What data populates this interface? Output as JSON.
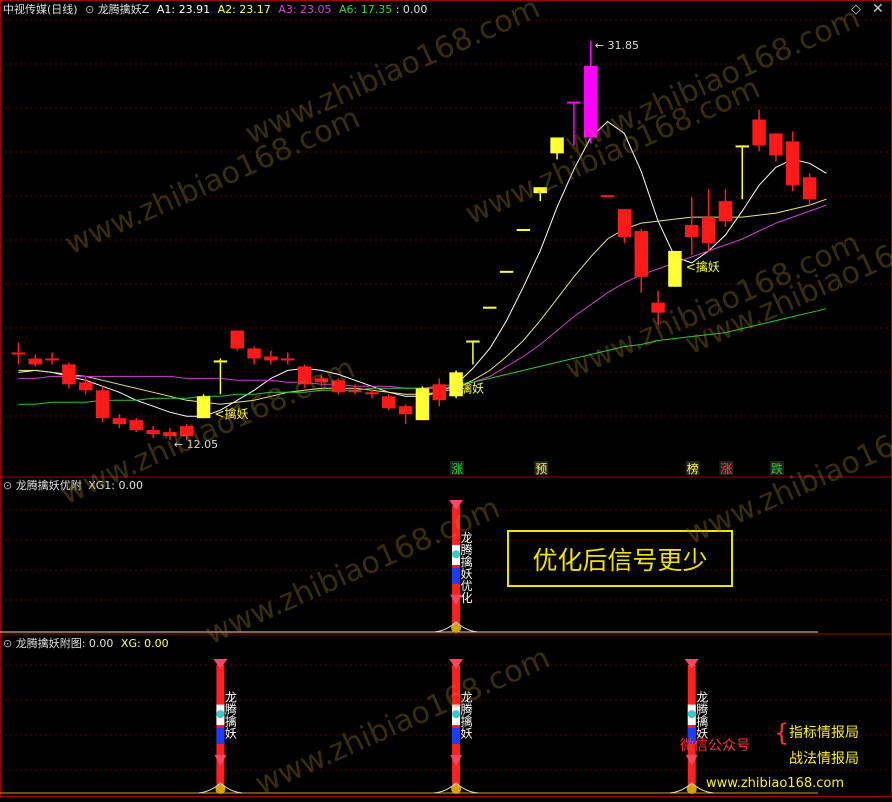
{
  "header": {
    "stock_name": "中视传媒",
    "period": "(日线)",
    "indicator_name": "龙腾擒妖Z",
    "a1": "A1: 23.91",
    "a2": "A2: 23.17",
    "a3": "A3: 23.05",
    "a6": "A6: 17.35",
    "extra": ": 0.00"
  },
  "colors": {
    "up": "#ff1a1a",
    "down_or_yellow": "#ffff33",
    "magenta": "#ff00ff",
    "ma_white": "#ffffff",
    "ma_yellow": "#e6e68a",
    "ma_magenta": "#d040d0",
    "ma_green": "#2ec82e",
    "signal_red": "#ff2020",
    "signal_blue": "#1a3cff",
    "grid": "#5a0000",
    "border": "#a00000"
  },
  "chart_data": {
    "type": "candlestick",
    "title": "中视传媒 (日线)",
    "price_labels": {
      "high": "31.85",
      "low": "12.05"
    },
    "ylim": [
      11,
      33
    ],
    "x": [
      1,
      2,
      3,
      4,
      5,
      6,
      7,
      8,
      9,
      10,
      11,
      12,
      13,
      14,
      15,
      16,
      17,
      18,
      19,
      20,
      21,
      22,
      23,
      24,
      25,
      26,
      27,
      28,
      29,
      30,
      31,
      32,
      33,
      34,
      35,
      36,
      37,
      38,
      39,
      40,
      41,
      42,
      43,
      44,
      45,
      46,
      47,
      48
    ],
    "candles": [
      {
        "o": 16.2,
        "h": 16.7,
        "l": 15.6,
        "c": 16.1,
        "col": "red"
      },
      {
        "o": 15.9,
        "h": 16.1,
        "l": 15.5,
        "c": 15.6,
        "col": "red"
      },
      {
        "o": 15.9,
        "h": 16.2,
        "l": 15.6,
        "c": 15.8,
        "col": "red"
      },
      {
        "o": 15.6,
        "h": 15.7,
        "l": 14.4,
        "c": 14.6,
        "col": "red"
      },
      {
        "o": 14.7,
        "h": 15.0,
        "l": 14.1,
        "c": 14.3,
        "col": "red"
      },
      {
        "o": 14.3,
        "h": 14.5,
        "l": 12.7,
        "c": 12.9,
        "col": "red"
      },
      {
        "o": 12.9,
        "h": 13.1,
        "l": 12.4,
        "c": 12.6,
        "col": "red"
      },
      {
        "o": 12.8,
        "h": 12.9,
        "l": 12.2,
        "c": 12.3,
        "col": "red"
      },
      {
        "o": 12.3,
        "h": 12.5,
        "l": 11.9,
        "c": 12.1,
        "col": "red"
      },
      {
        "o": 12.2,
        "h": 12.4,
        "l": 11.8,
        "c": 12.0,
        "col": "red"
      },
      {
        "o": 12.0,
        "h": 12.6,
        "l": 11.8,
        "c": 12.5,
        "col": "red"
      },
      {
        "o": 12.9,
        "h": 14.1,
        "l": 12.9,
        "c": 14.0,
        "col": "yellow"
      },
      {
        "o": 15.8,
        "h": 15.9,
        "l": 14.1,
        "c": 15.8,
        "col": "yellow"
      },
      {
        "o": 17.3,
        "h": 17.3,
        "l": 16.3,
        "c": 16.4,
        "col": "red"
      },
      {
        "o": 16.4,
        "h": 16.5,
        "l": 15.6,
        "c": 15.9,
        "col": "red"
      },
      {
        "o": 16.0,
        "h": 16.3,
        "l": 15.6,
        "c": 15.8,
        "col": "red"
      },
      {
        "o": 15.9,
        "h": 16.2,
        "l": 15.6,
        "c": 15.8,
        "col": "red"
      },
      {
        "o": 15.5,
        "h": 15.6,
        "l": 14.4,
        "c": 14.6,
        "col": "red"
      },
      {
        "o": 14.9,
        "h": 15.1,
        "l": 14.5,
        "c": 14.7,
        "col": "red"
      },
      {
        "o": 14.8,
        "h": 14.9,
        "l": 14.1,
        "c": 14.2,
        "col": "red"
      },
      {
        "o": 14.3,
        "h": 14.6,
        "l": 14.1,
        "c": 14.3,
        "col": "red"
      },
      {
        "o": 14.2,
        "h": 14.4,
        "l": 13.9,
        "c": 14.1,
        "col": "red"
      },
      {
        "o": 14.0,
        "h": 14.1,
        "l": 13.3,
        "c": 13.4,
        "col": "red"
      },
      {
        "o": 13.5,
        "h": 13.6,
        "l": 12.6,
        "c": 13.1,
        "col": "red"
      },
      {
        "o": 12.8,
        "h": 14.5,
        "l": 12.8,
        "c": 14.4,
        "col": "yellow"
      },
      {
        "o": 13.8,
        "h": 14.9,
        "l": 13.5,
        "c": 14.6,
        "col": "red"
      },
      {
        "o": 14.0,
        "h": 15.3,
        "l": 13.9,
        "c": 15.2,
        "col": "yellow"
      },
      {
        "o": 16.8,
        "h": 16.8,
        "l": 15.6,
        "c": 16.8,
        "col": "yellow"
      },
      {
        "o": 18.5,
        "h": 18.5,
        "l": 18.5,
        "c": 18.5,
        "col": "yellow"
      },
      {
        "o": 20.3,
        "h": 20.3,
        "l": 20.3,
        "c": 20.3,
        "col": "yellow"
      },
      {
        "o": 22.4,
        "h": 22.4,
        "l": 22.4,
        "c": 22.4,
        "col": "yellow"
      },
      {
        "o": 24.5,
        "h": 24.5,
        "l": 23.8,
        "c": 24.2,
        "col": "yellow"
      },
      {
        "o": 26.2,
        "h": 27.0,
        "l": 25.9,
        "c": 27.0,
        "col": "yellow"
      },
      {
        "o": 28.8,
        "h": 28.8,
        "l": 26.6,
        "c": 28.8,
        "col": "magenta"
      },
      {
        "o": 27.0,
        "h": 31.85,
        "l": 26.7,
        "c": 30.6,
        "col": "magenta"
      },
      {
        "o": 24.1,
        "h": 24.1,
        "l": 24.1,
        "c": 24.1,
        "col": "red"
      },
      {
        "o": 23.4,
        "h": 23.4,
        "l": 21.7,
        "c": 22.0,
        "col": "red"
      },
      {
        "o": 22.3,
        "h": 22.4,
        "l": 19.2,
        "c": 20.0,
        "col": "red"
      },
      {
        "o": 18.7,
        "h": 19.3,
        "l": 17.6,
        "c": 18.2,
        "col": "red"
      },
      {
        "o": 19.5,
        "h": 21.3,
        "l": 19.5,
        "c": 21.3,
        "col": "yellow"
      },
      {
        "o": 22.6,
        "h": 24.0,
        "l": 21.1,
        "c": 22.0,
        "col": "red"
      },
      {
        "o": 23.0,
        "h": 24.4,
        "l": 21.3,
        "c": 21.7,
        "col": "red"
      },
      {
        "o": 23.8,
        "h": 24.4,
        "l": 22.5,
        "c": 22.8,
        "col": "red"
      },
      {
        "o": 26.6,
        "h": 26.6,
        "l": 23.9,
        "c": 26.6,
        "col": "yellow"
      },
      {
        "o": 27.9,
        "h": 28.4,
        "l": 26.3,
        "c": 26.6,
        "col": "red"
      },
      {
        "o": 27.2,
        "h": 27.2,
        "l": 25.8,
        "c": 26.1,
        "col": "red"
      },
      {
        "o": 26.8,
        "h": 27.3,
        "l": 24.3,
        "c": 24.6,
        "col": "red"
      },
      {
        "o": 25.0,
        "h": 25.2,
        "l": 23.6,
        "c": 23.9,
        "col": "red"
      }
    ],
    "lines": [
      {
        "name": "A1",
        "color": "#ffffff",
        "values": [
          15.2,
          15.3,
          15.2,
          15.0,
          14.8,
          14.5,
          14.2,
          13.8,
          13.5,
          13.2,
          13.0,
          13.0,
          13.3,
          13.8,
          14.3,
          14.9,
          15.3,
          15.4,
          15.3,
          15.1,
          14.8,
          14.5,
          14.2,
          14.0,
          14.0,
          14.2,
          14.6,
          15.4,
          16.4,
          17.8,
          19.5,
          21.3,
          23.5,
          25.4,
          27.0,
          27.8,
          27.2,
          25.3,
          22.8,
          21.0,
          20.7,
          21.3,
          22.1,
          23.3,
          24.6,
          25.5,
          25.9,
          25.7,
          25.2
        ]
      },
      {
        "name": "A2",
        "color": "#e6e68a",
        "values": [
          15.3,
          15.3,
          15.2,
          15.1,
          15.0,
          14.8,
          14.6,
          14.4,
          14.2,
          14.0,
          13.8,
          13.7,
          13.6,
          13.7,
          13.8,
          14.0,
          14.2,
          14.3,
          14.4,
          14.4,
          14.4,
          14.3,
          14.2,
          14.1,
          14.1,
          14.2,
          14.4,
          14.8,
          15.3,
          16.0,
          16.8,
          17.8,
          18.9,
          20.0,
          21.0,
          21.9,
          22.4,
          22.7,
          22.8,
          22.9,
          23.0,
          23.0,
          23.0,
          23.0,
          23.1,
          23.2,
          23.4,
          23.6,
          23.9
        ]
      },
      {
        "name": "A3",
        "color": "#d040d0",
        "values": [
          14.9,
          14.9,
          15.0,
          15.0,
          15.0,
          15.0,
          15.0,
          15.0,
          15.0,
          15.0,
          14.9,
          14.9,
          14.9,
          14.8,
          14.8,
          14.8,
          14.7,
          14.7,
          14.6,
          14.6,
          14.5,
          14.5,
          14.5,
          14.4,
          14.4,
          14.4,
          14.5,
          14.7,
          15.0,
          15.5,
          16.0,
          16.6,
          17.3,
          18.0,
          18.6,
          19.2,
          19.7,
          20.1,
          20.4,
          20.7,
          21.0,
          21.3,
          21.6,
          21.9,
          22.3,
          22.7,
          23.0,
          23.3,
          23.6
        ]
      },
      {
        "name": "A6",
        "color": "#2ec82e",
        "values": [
          13.6,
          13.6,
          13.7,
          13.7,
          13.7,
          13.8,
          13.8,
          13.8,
          13.9,
          13.9,
          13.9,
          14.0,
          14.0,
          14.1,
          14.1,
          14.2,
          14.2,
          14.2,
          14.3,
          14.3,
          14.3,
          14.4,
          14.4,
          14.4,
          14.4,
          14.5,
          14.6,
          14.7,
          14.9,
          15.1,
          15.3,
          15.5,
          15.7,
          15.9,
          16.1,
          16.3,
          16.5,
          16.6,
          16.8,
          16.9,
          17.0,
          17.1,
          17.2,
          17.4,
          17.6,
          17.8,
          18.0,
          18.2,
          18.4
        ]
      }
    ],
    "signals": [
      {
        "idx": 12,
        "label": "擒妖"
      },
      {
        "idx": 26,
        "label": "擒妖"
      },
      {
        "idx": 40,
        "label": "擒妖"
      }
    ],
    "markers": [
      {
        "idx": 26,
        "text": "涨",
        "color": "#2ec82e"
      },
      {
        "idx": 31,
        "text": "预",
        "color": "#ffff33"
      },
      {
        "idx": 40,
        "text": "榜",
        "color": "#ffff33"
      },
      {
        "idx": 42,
        "text": "涨",
        "color": "#ff4040"
      },
      {
        "idx": 45,
        "text": "跌",
        "color": "#2ec82e"
      }
    ]
  },
  "panel2": {
    "title": "龙腾擒妖优附",
    "values": "XG1: 0.00",
    "signal_text": "龙腾擒妖优化",
    "callout": "优化后信号更少"
  },
  "panel3": {
    "title": "龙腾擒妖附图",
    "value1": ": 0.00",
    "value2": "XG: 0.00",
    "signal_text": "龙腾擒妖"
  },
  "promo": {
    "line1": "指标情报局",
    "line2": "战法情报局",
    "wechat": "微信公众号",
    "url": "www.zhibiao168.com"
  },
  "watermark": "www.zhibiao168.com"
}
